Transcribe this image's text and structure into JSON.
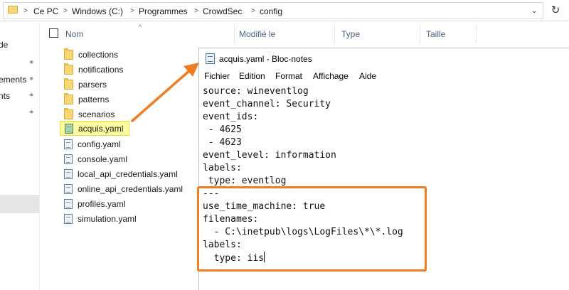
{
  "address_bar": {
    "crumbs": [
      "Ce PC",
      "Windows (C:)",
      "Programmes",
      "CrowdSec",
      "config"
    ],
    "separator": ">",
    "dropdown": "⌄",
    "refresh": "↻"
  },
  "nav_pane": {
    "items": [
      "de",
      "ements",
      "nts"
    ],
    "pin": "📌"
  },
  "columns": {
    "name": "Nom",
    "modified": "Modifié le",
    "type": "Type",
    "size": "Taille",
    "sort_caret": "^"
  },
  "files": [
    {
      "name": "collections",
      "kind": "folder"
    },
    {
      "name": "notifications",
      "kind": "folder"
    },
    {
      "name": "parsers",
      "kind": "folder"
    },
    {
      "name": "patterns",
      "kind": "folder"
    },
    {
      "name": "scenarios",
      "kind": "folder"
    },
    {
      "name": "acquis.yaml",
      "kind": "yaml",
      "selected": true
    },
    {
      "name": "config.yaml",
      "kind": "yaml"
    },
    {
      "name": "console.yaml",
      "kind": "yaml"
    },
    {
      "name": "local_api_credentials.yaml",
      "kind": "yaml"
    },
    {
      "name": "online_api_credentials.yaml",
      "kind": "yaml"
    },
    {
      "name": "profiles.yaml",
      "kind": "yaml"
    },
    {
      "name": "simulation.yaml",
      "kind": "yaml"
    }
  ],
  "notepad": {
    "title": "acquis.yaml - Bloc-notes",
    "menu": [
      "Fichier",
      "Edition",
      "Format",
      "Affichage",
      "Aide"
    ],
    "lines": [
      "source: wineventlog",
      "event_channel: Security",
      "event_ids:",
      " - 4625",
      " - 4623",
      "event_level: information",
      "labels:",
      " type: eventlog",
      "---",
      "use_time_machine: true",
      "filenames:",
      "  - C:\\inetpub\\logs\\LogFiles\\*\\*.log",
      "labels:",
      "  type: iis"
    ]
  },
  "colors": {
    "highlight": "#f07d22",
    "selected_file_bg": "#fdfca1",
    "column_header_text": "#4d6082"
  }
}
